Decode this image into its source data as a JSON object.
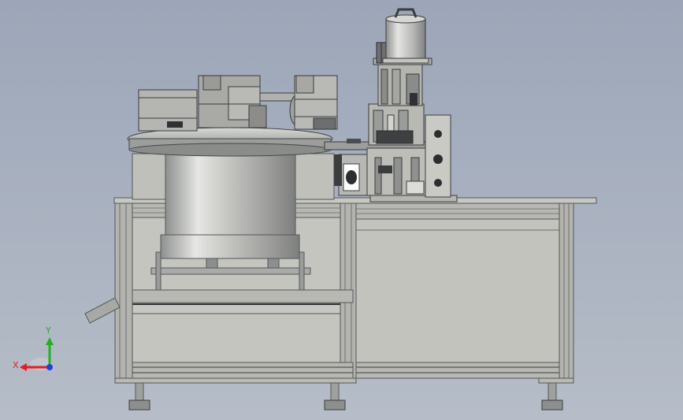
{
  "view": {
    "background_top": "#9ca6b8",
    "background_bottom": "#b6bdc8"
  },
  "triad": {
    "x_label": "X",
    "y_label": "Y",
    "x_color": "#e02020",
    "y_color": "#20b020",
    "z_color": "#2040e0"
  },
  "machine": {
    "frame_color": "#b9bab3",
    "panel_color": "#c4c5bf",
    "steel_color": "#a8aaa8",
    "dark_color": "#3a3c3e"
  }
}
